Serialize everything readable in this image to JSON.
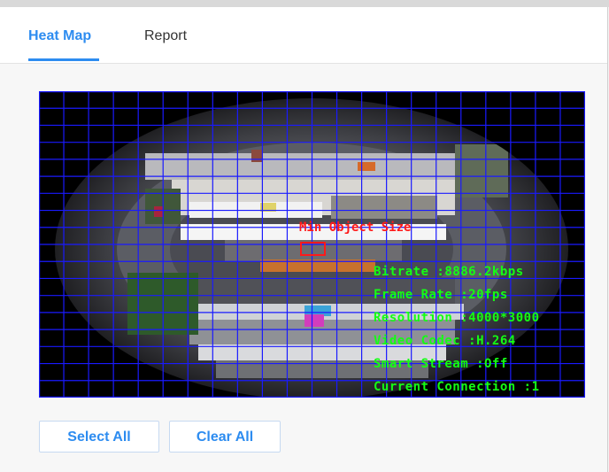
{
  "tabs": [
    {
      "label": "Heat Map",
      "active": true
    },
    {
      "label": "Report",
      "active": false
    }
  ],
  "video": {
    "overlay_label": "Min Object Size",
    "osd_lines": [
      "Bitrate :8886.2kbps",
      "Frame Rate :20fps",
      "Resolution :4000*3000",
      "Video Codec :H.264",
      "Smart Stream :Off",
      "Current Connection :1"
    ],
    "grid_color": "#1a1aff",
    "osd_color": "#14ff14",
    "label_color": "#ff1a1a"
  },
  "buttons": {
    "select_all": "Select All",
    "clear_all": "Clear All"
  },
  "colors": {
    "accent": "#2d8cf0"
  }
}
